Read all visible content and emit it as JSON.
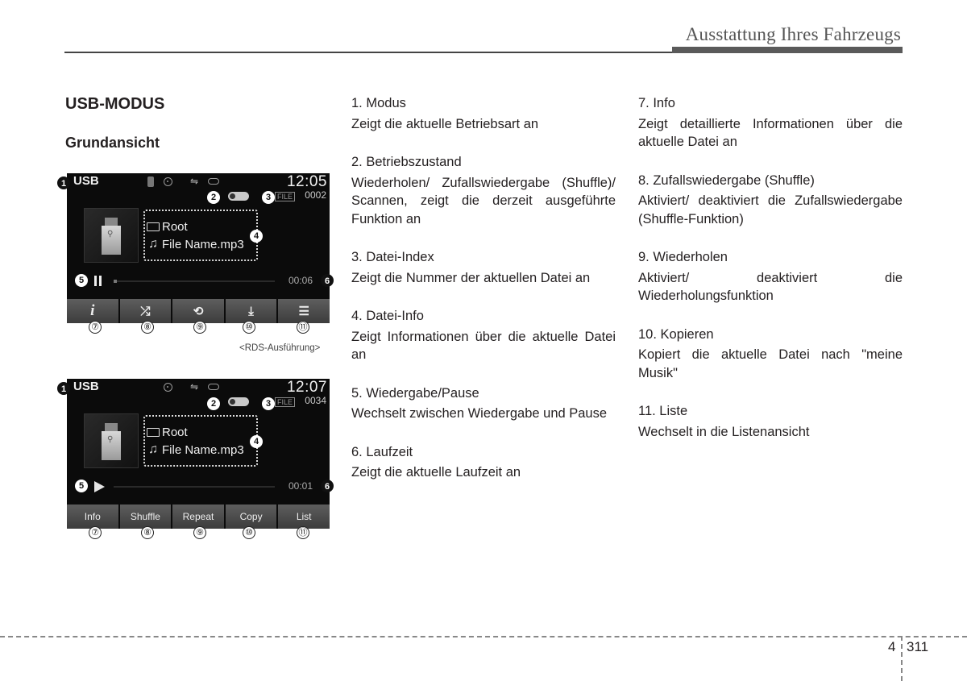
{
  "header": {
    "title": "Ausstattung Ihres Fahrzeugs"
  },
  "section": {
    "title": "USB-MODUS",
    "subtitle": "Grundansicht"
  },
  "screens": [
    {
      "variant": "rds",
      "mode": "USB",
      "clock": "12:05",
      "status_icons": [
        "bluetooth-icon",
        "cd-icon",
        "usb-icon",
        "battery-icon"
      ],
      "state_indicator": "repeat",
      "file_tag": "FILE",
      "file_index": "0002",
      "folder": "Root",
      "file_name": "File Name.mp3",
      "playback": "pause",
      "elapsed": "00:06",
      "progress_percent": 2,
      "buttons": [
        {
          "icon": "info-icon",
          "glyph": "i"
        },
        {
          "icon": "shuffle-icon",
          "glyph": "⤮"
        },
        {
          "icon": "repeat-icon",
          "glyph": "⟲"
        },
        {
          "icon": "copy-icon",
          "glyph": "⤓"
        },
        {
          "icon": "list-icon",
          "glyph": "☰"
        }
      ],
      "caption": "<RDS-Ausführung>"
    },
    {
      "variant": "standard",
      "mode": "USB",
      "clock": "12:07",
      "status_icons": [
        "cd-icon",
        "usb-icon",
        "battery-icon"
      ],
      "state_indicator": "shuffle",
      "file_tag": "FILE",
      "file_index": "0034",
      "folder": "Root",
      "file_name": "File Name.mp3",
      "playback": "play",
      "elapsed": "00:01",
      "progress_percent": 0,
      "buttons": [
        {
          "label": "Info"
        },
        {
          "label": "Shuffle"
        },
        {
          "label": "Repeat"
        },
        {
          "label": "Copy"
        },
        {
          "label": "List"
        }
      ]
    }
  ],
  "callouts": [
    "①",
    "②",
    "③",
    "④",
    "⑤",
    "⑥",
    "⑦",
    "⑧",
    "⑨",
    "⑩",
    "⑪"
  ],
  "callout_nums": [
    "1",
    "2",
    "3",
    "4",
    "5",
    "6"
  ],
  "items": [
    {
      "title": "1. Modus",
      "desc": "Zeigt die aktuelle Betriebsart an"
    },
    {
      "title": "2. Betriebszustand",
      "desc": "Wiederholen/ Zufallswiedergabe (Shuffle)/ Scannen, zeigt die derzeit ausgeführte Funktion an"
    },
    {
      "title": "3. Datei-Index",
      "desc": "Zeigt die Nummer der aktuellen Datei an"
    },
    {
      "title": "4. Datei-Info",
      "desc": "Zeigt Informationen über die aktuelle Datei an"
    },
    {
      "title": "5. Wiedergabe/Pause",
      "desc": "Wechselt zwischen Wiedergabe und Pause"
    },
    {
      "title": "6. Laufzeit",
      "desc": "Zeigt die aktuelle Laufzeit an"
    },
    {
      "title": "7. Info",
      "desc": "Zeigt detaillierte Informationen über die aktuelle Datei an"
    },
    {
      "title": "8. Zufallswiedergabe (Shuffle)",
      "desc": "Aktiviert/ deaktiviert die Zufallswiedergabe (Shuffle-Funktion)"
    },
    {
      "title": "9. Wiederholen",
      "desc": "Aktiviert/ deaktiviert die Wiederholungsfunktion"
    },
    {
      "title": "10. Kopieren",
      "desc": "Kopiert die aktuelle Datei nach \"meine Musik\""
    },
    {
      "title": "11. Liste",
      "desc": "Wechselt in die Listenansicht"
    }
  ],
  "footer": {
    "chapter": "4",
    "page": "311"
  }
}
